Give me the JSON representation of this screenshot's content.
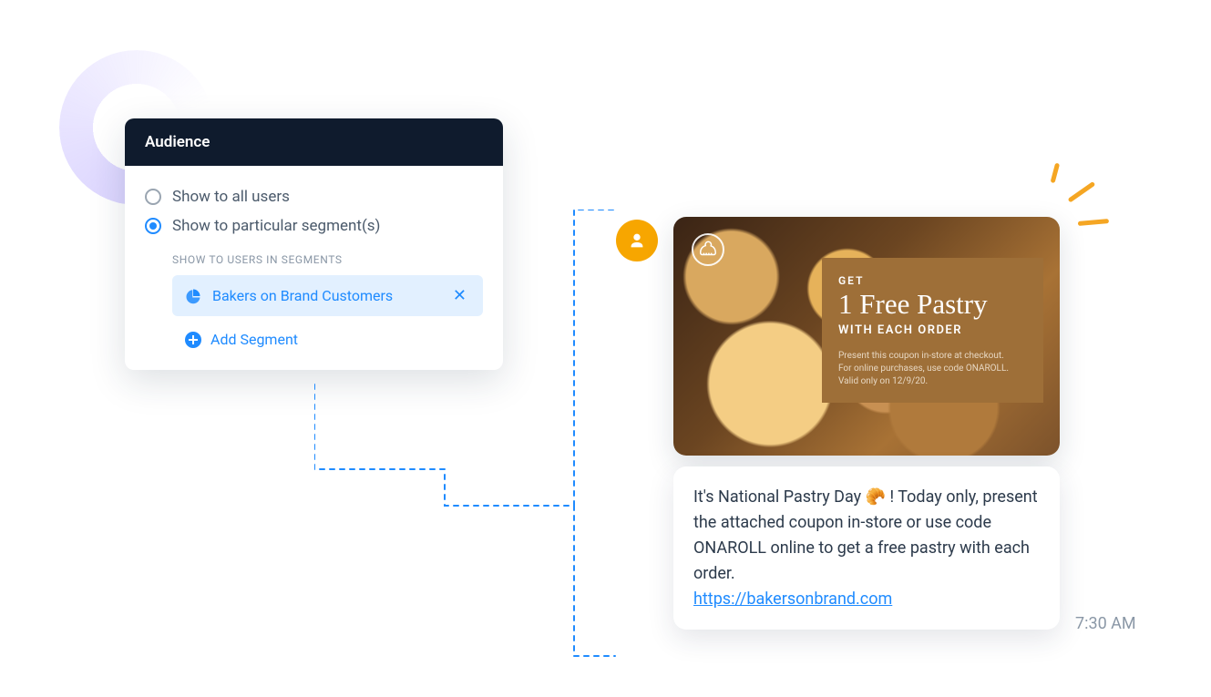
{
  "audience": {
    "header": "Audience",
    "option_all": "Show to all users",
    "option_segments": "Show to particular segment(s)",
    "selected_option": "segments",
    "segments_label": "SHOW TO USERS IN SEGMENTS",
    "segments": [
      {
        "name": "Bakers on Brand Customers"
      }
    ],
    "add_segment_label": "Add Segment"
  },
  "coupon": {
    "get": "GET",
    "title": "1 Free Pastry",
    "sub": "WITH EACH ORDER",
    "fine1": "Present this coupon in-store at checkout.",
    "fine2": "For online purchases, use code ONAROLL.",
    "fine3": "Valid only on 12/9/20."
  },
  "message": {
    "text_before_emoji": "It's National Pastry Day ",
    "emoji": "🥐",
    "text_after_emoji": " ! Today only, present the attached coupon in-store or use code ONAROLL online to get a free pastry with each order.",
    "link_text": "https://bakersonbrand.com"
  },
  "timestamp": "7:30 AM"
}
